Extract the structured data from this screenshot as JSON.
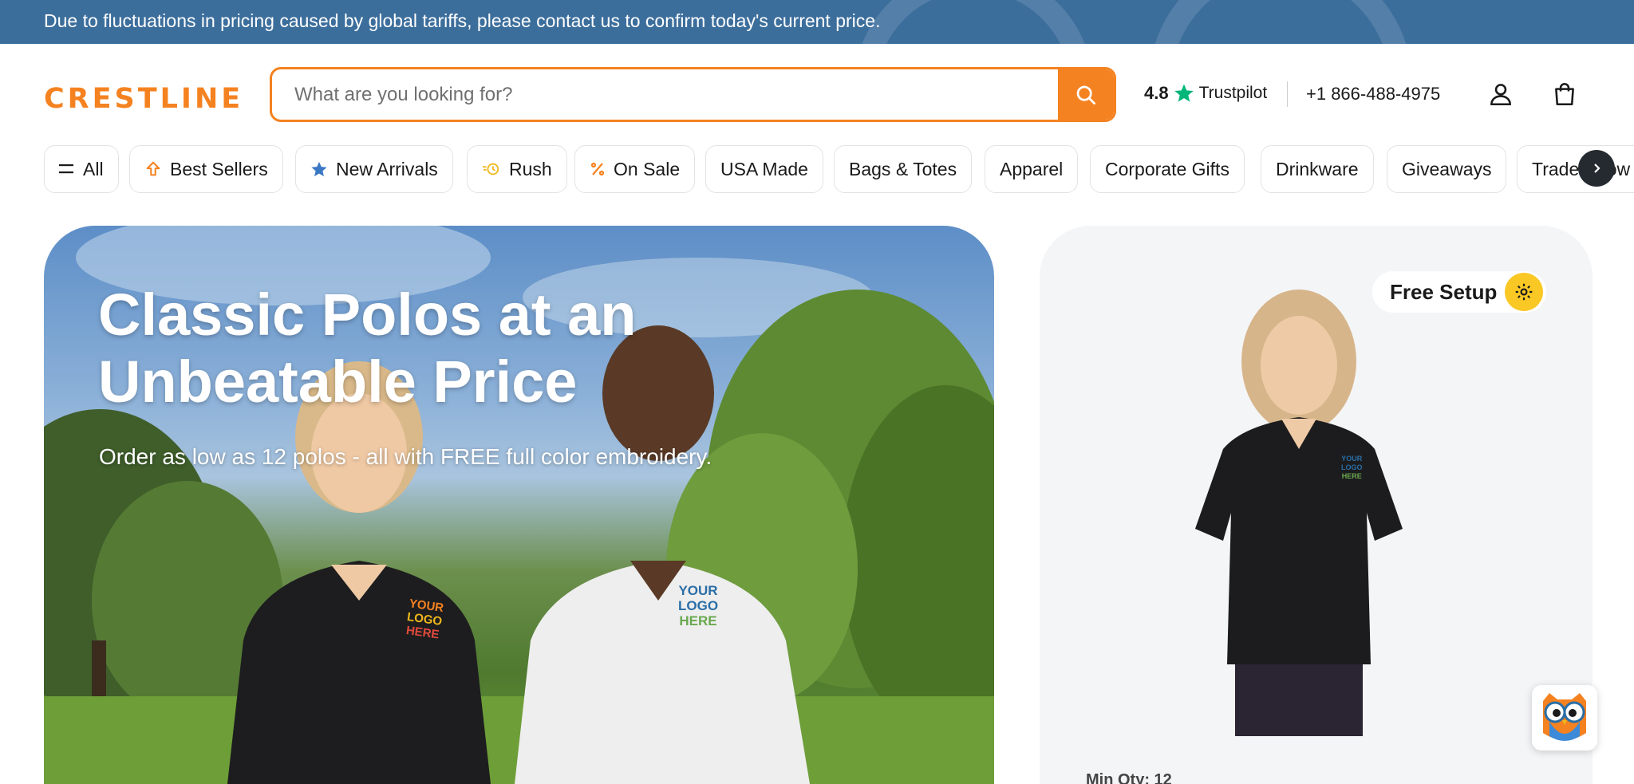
{
  "banner": {
    "text": "Due to fluctuations in pricing caused by global tariffs, please contact us to confirm today's current price."
  },
  "header": {
    "logo": "CRESTLINE",
    "search_placeholder": "What are you looking for?",
    "rating": "4.8",
    "rating_source": "Trustpilot",
    "phone": "+1 866-488-4975"
  },
  "nav": {
    "items": [
      {
        "label": "All",
        "icon": "menu-icon"
      },
      {
        "label": "Best Sellers",
        "icon": "arrow-up-icon"
      },
      {
        "label": "New Arrivals",
        "icon": "star-icon"
      },
      {
        "label": "Rush",
        "icon": "fast-clock-icon"
      },
      {
        "label": "On Sale",
        "icon": "percent-icon"
      },
      {
        "label": "USA Made"
      },
      {
        "label": "Bags & Totes"
      },
      {
        "label": "Apparel"
      },
      {
        "label": "Corporate Gifts"
      },
      {
        "label": "Drinkware"
      },
      {
        "label": "Giveaways"
      },
      {
        "label": "Trade Show"
      }
    ]
  },
  "hero": {
    "title": "Classic Polos at an Unbeatable Price",
    "subtitle": "Order as low as 12 polos - all with FREE full color embroidery.",
    "shirt_logo_text": [
      "YOUR",
      "LOGO",
      "HERE"
    ]
  },
  "product": {
    "badge": "Free Setup",
    "min_qty": "Min Qty: 12",
    "shirt_logo_text": [
      "YOUR",
      "LOGO",
      "HERE"
    ]
  },
  "colors": {
    "brand_orange": "#f58220",
    "banner_blue": "#3c6e9c",
    "trustpilot_green": "#00b67a",
    "badge_yellow": "#f9c825"
  }
}
